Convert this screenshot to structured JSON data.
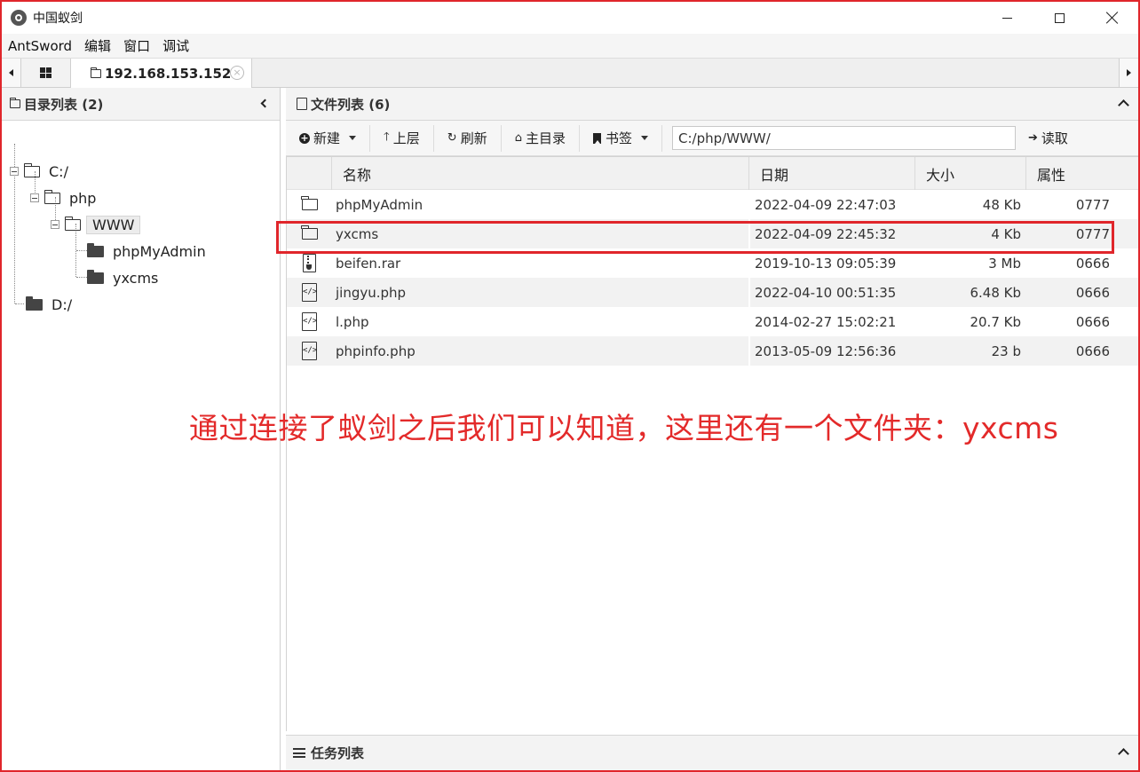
{
  "window": {
    "title": "中国蚁剑",
    "min_icon": "minimize-icon",
    "max_icon": "maximize-icon",
    "close_icon": "close-icon"
  },
  "menu": [
    "AntSword",
    "编辑",
    "窗口",
    "调试"
  ],
  "tabs": {
    "active_label": "192.168.153.152",
    "close_glyph": "×"
  },
  "left_panel": {
    "title": "目录列表 (2)",
    "tree": [
      {
        "label": "C:/",
        "level": 0,
        "expanded": true
      },
      {
        "label": "php",
        "level": 1,
        "expanded": true
      },
      {
        "label": "WWW",
        "level": 2,
        "expanded": true,
        "selected": true
      },
      {
        "label": "phpMyAdmin",
        "level": 3
      },
      {
        "label": "yxcms",
        "level": 3
      },
      {
        "label": "D:/",
        "level": 0
      }
    ]
  },
  "right_panel": {
    "title": "文件列表 (6)",
    "toolbar": {
      "new_label": "新建",
      "up_label": "上层",
      "refresh_label": "刷新",
      "home_label": "主目录",
      "bookmark_label": "书签",
      "path_value": "C:/php/WWW/",
      "read_label": "读取"
    },
    "columns": [
      "名称",
      "日期",
      "大小",
      "属性"
    ],
    "files": [
      {
        "icon": "folder-icon",
        "name": "phpMyAdmin",
        "date": "2022-04-09 22:47:03",
        "size": "48 Kb",
        "attr": "0777"
      },
      {
        "icon": "folder-icon",
        "name": "yxcms",
        "date": "2022-04-09 22:45:32",
        "size": "4 Kb",
        "attr": "0777"
      },
      {
        "icon": "archive-file-icon",
        "name": "beifen.rar",
        "date": "2019-10-13 09:05:39",
        "size": "3 Mb",
        "attr": "0666"
      },
      {
        "icon": "code-file-icon",
        "name": "jingyu.php",
        "date": "2022-04-10 00:51:35",
        "size": "6.48 Kb",
        "attr": "0666"
      },
      {
        "icon": "code-file-icon",
        "name": "l.php",
        "date": "2014-02-27 15:02:21",
        "size": "20.7 Kb",
        "attr": "0666"
      },
      {
        "icon": "code-file-icon",
        "name": "phpinfo.php",
        "date": "2013-05-09 12:56:36",
        "size": "23 b",
        "attr": "0666"
      }
    ]
  },
  "annotation": "通过连接了蚁剑之后我们可以知道，这里还有一个文件夹：yxcms",
  "task_panel": {
    "title": "任务列表"
  },
  "colors": {
    "annotation": "#e32a2a",
    "frame": "#e0262b"
  }
}
